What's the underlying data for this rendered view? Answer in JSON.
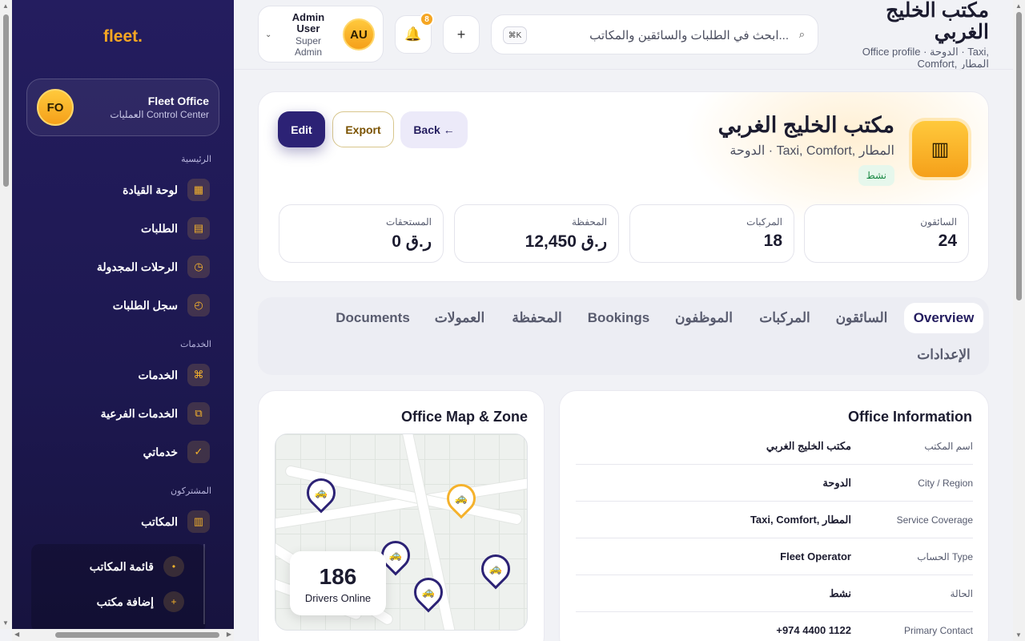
{
  "sidebar": {
    "logo": "fleet.",
    "office_card": {
      "initials": "FO",
      "name": "Fleet Office",
      "subtitle": "العمليات Control Center"
    },
    "sections": {
      "main": "الرئيسية",
      "services": "الخدمات",
      "subscribers": "المشتركون"
    },
    "items": {
      "dashboard": {
        "label": "لوحة القيادة",
        "icon": "dashboard-icon"
      },
      "bookings": {
        "label": "الطلبات",
        "icon": "list-icon"
      },
      "scheduled": {
        "label": "الرحلات المجدولة",
        "icon": "clock-icon"
      },
      "history": {
        "label": "سجل الطلبات",
        "icon": "history-icon"
      },
      "services": {
        "label": "الخدمات",
        "icon": "command-icon"
      },
      "subservices": {
        "label": "الخدمات الفرعية",
        "icon": "copy-icon"
      },
      "my_services": {
        "label": "خدماتي",
        "icon": "check-icon"
      },
      "offices": {
        "label": "المكاتب",
        "icon": "building-icon"
      }
    },
    "sub_items": {
      "office_list": {
        "label": "قائمة المكاتب",
        "icon": "dot-icon"
      },
      "add_office": {
        "label": "إضافة مكتب",
        "icon": "plus-icon"
      }
    }
  },
  "topbar": {
    "page_title": "مكتب الخليج الغربي",
    "page_subtitle": "Office profile · الدوحة · Taxi, Comfort, المطار",
    "search": {
      "placeholder": "ابحث في الطلبات والسائقين والمكاتب...",
      "shortcut": "⌘K",
      "icon": "search-icon"
    },
    "add_label": "+",
    "notifications_count": "8",
    "user": {
      "initials": "AU",
      "name": "Admin User",
      "role": "Super Admin"
    }
  },
  "hero": {
    "office_name": "مكتب الخليج الغربي",
    "location": "الدوحة · Taxi, Comfort, المطار",
    "status": "نشط",
    "buttons": {
      "back": "Back ←",
      "export": "Export",
      "edit": "Edit"
    },
    "stats": {
      "drivers": {
        "label": "السائقون",
        "value": "24"
      },
      "vehicles": {
        "label": "المركبات",
        "value": "18"
      },
      "wallet": {
        "label": "المحفظة",
        "value": "ر.ق 12,450"
      },
      "dues": {
        "label": "المستحقات",
        "value": "ر.ق 0"
      }
    }
  },
  "tabs": {
    "overview": "Overview",
    "drivers": "السائقون",
    "vehicles": "المركبات",
    "staff": "الموظفون",
    "bookings": "Bookings",
    "wallet": "المحفظة",
    "commissions": "العمولات",
    "documents": "Documents",
    "settings": "الإعدادات",
    "active": "overview"
  },
  "office_info": {
    "title": "Office Information",
    "rows": [
      {
        "label": "اسم المكتب",
        "value": "مكتب الخليج الغربي"
      },
      {
        "label": "City / Region",
        "value": "الدوحة"
      },
      {
        "label": "Service Coverage",
        "value": "Taxi, Comfort, المطار"
      },
      {
        "label": "الحساب Type",
        "value": "Fleet Operator"
      },
      {
        "label": "الحالة",
        "value": "نشط"
      },
      {
        "label": "Primary Contact",
        "value": "+974 4400 1122"
      }
    ]
  },
  "map_panel": {
    "title": "Office Map & Zone",
    "drivers_online": {
      "count": "186",
      "label": "Drivers Online"
    }
  },
  "colors": {
    "sidebar_bg": "#241d5f",
    "accent": "#f5a623",
    "primary": "#2c2275",
    "status_active": "#1c8a46"
  }
}
